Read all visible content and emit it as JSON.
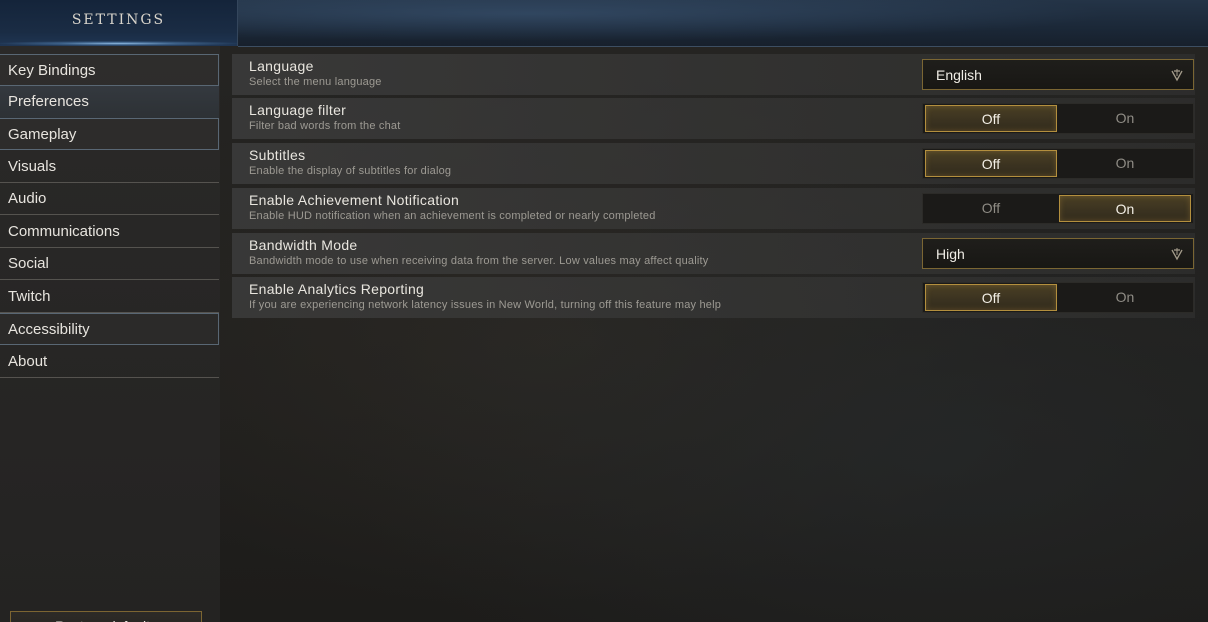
{
  "header": {
    "title": "SETTINGS"
  },
  "sidebar": {
    "items": [
      {
        "label": "Key Bindings"
      },
      {
        "label": "Preferences"
      },
      {
        "label": "Gameplay"
      },
      {
        "label": "Visuals"
      },
      {
        "label": "Audio"
      },
      {
        "label": "Communications"
      },
      {
        "label": "Social"
      },
      {
        "label": "Twitch"
      },
      {
        "label": "Accessibility"
      },
      {
        "label": "About"
      }
    ],
    "selected": "Preferences",
    "restore_label": "Restore defaults"
  },
  "settings": [
    {
      "title": "Language",
      "description": "Select the menu language",
      "control": "dropdown",
      "value": "English"
    },
    {
      "title": "Language filter",
      "description": "Filter bad words from the chat",
      "control": "toggle",
      "off_label": "Off",
      "on_label": "On",
      "selected": "Off"
    },
    {
      "title": "Subtitles",
      "description": "Enable the display of subtitles for dialog",
      "control": "toggle",
      "off_label": "Off",
      "on_label": "On",
      "selected": "Off"
    },
    {
      "title": "Enable Achievement Notification",
      "description": "Enable HUD notification when an achievement is completed or nearly completed",
      "control": "toggle",
      "off_label": "Off",
      "on_label": "On",
      "selected": "On"
    },
    {
      "title": "Bandwidth Mode",
      "description": "Bandwidth mode to use when receiving data from the server. Low values may affect quality",
      "control": "dropdown",
      "value": "High"
    },
    {
      "title": "Enable Analytics Reporting",
      "description": "If you are experiencing network latency issues in New World, turning off this feature may help",
      "control": "toggle",
      "off_label": "Off",
      "on_label": "On",
      "selected": "Off"
    }
  ],
  "colors": {
    "accent_gold": "#b38f3e",
    "panel_blue": "#1b2838",
    "text_primary": "#e9e6df",
    "text_secondary": "#9d9a93"
  },
  "icons": {
    "dropdown": "chevron-down-icon"
  }
}
